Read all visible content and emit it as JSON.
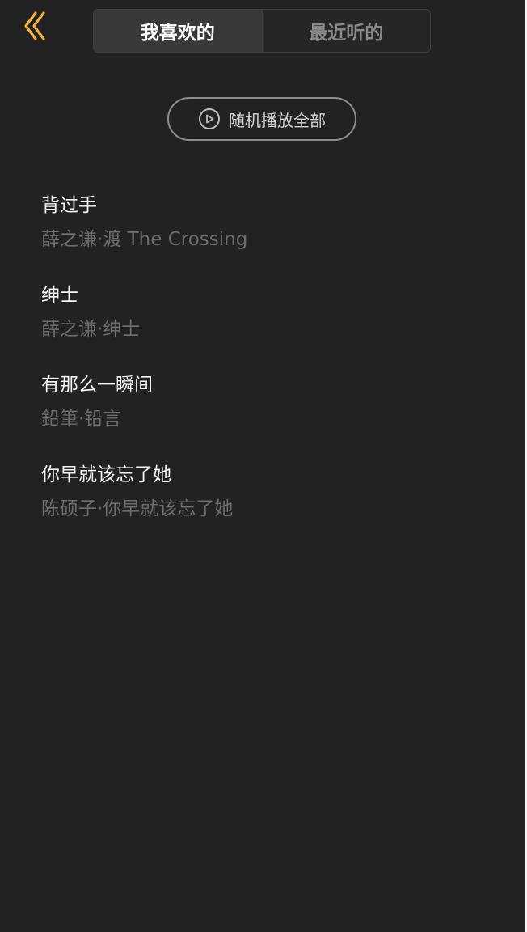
{
  "header": {
    "back_icon": "chevron-left-icon",
    "tabs": [
      {
        "label": "我喜欢的",
        "active": true
      },
      {
        "label": "最近听的",
        "active": false
      }
    ]
  },
  "shuffle": {
    "icon": "play-circle-icon",
    "label": "随机播放全部"
  },
  "songs": [
    {
      "title": "背过手",
      "subtitle": "薛之谦·渡 The Crossing"
    },
    {
      "title": "绅士",
      "subtitle": "薛之谦·绅士"
    },
    {
      "title": "有那么一瞬间",
      "subtitle": "鉛筆·铅言"
    },
    {
      "title": "你早就该忘了她",
      "subtitle": "陈硕子·你早就该忘了她"
    }
  ],
  "colors": {
    "background": "#222222",
    "accent": "#f0b43c",
    "title_text": "#f4f4f4",
    "subtitle_text": "#6c6c6c"
  }
}
